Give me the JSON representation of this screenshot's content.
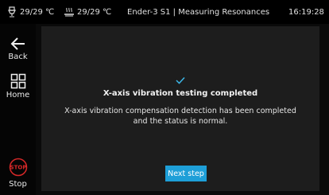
{
  "status_bar": {
    "nozzle_temp": "29/29 ℃",
    "bed_temp": "29/29 ℃",
    "printer_title": "Ender-3 S1 | Measuring Resonances",
    "time": "16:19:28",
    "nozzle_icon": "nozzle-temperature-icon",
    "bed_icon": "bed-temperature-icon"
  },
  "sidebar": {
    "back_label": "Back",
    "home_label": "Home",
    "stop_label": "Stop",
    "stop_icon_text": "STOP",
    "stop_color": "#d62828"
  },
  "main": {
    "check_icon": "checkmark-icon",
    "title": "X-axis vibration testing completed",
    "description": "X-axis vibration compensation detection has been completed and the status is normal.",
    "next_button": "Next step",
    "accent_color": "#1e9fd8",
    "check_color": "#3cb6e6"
  }
}
